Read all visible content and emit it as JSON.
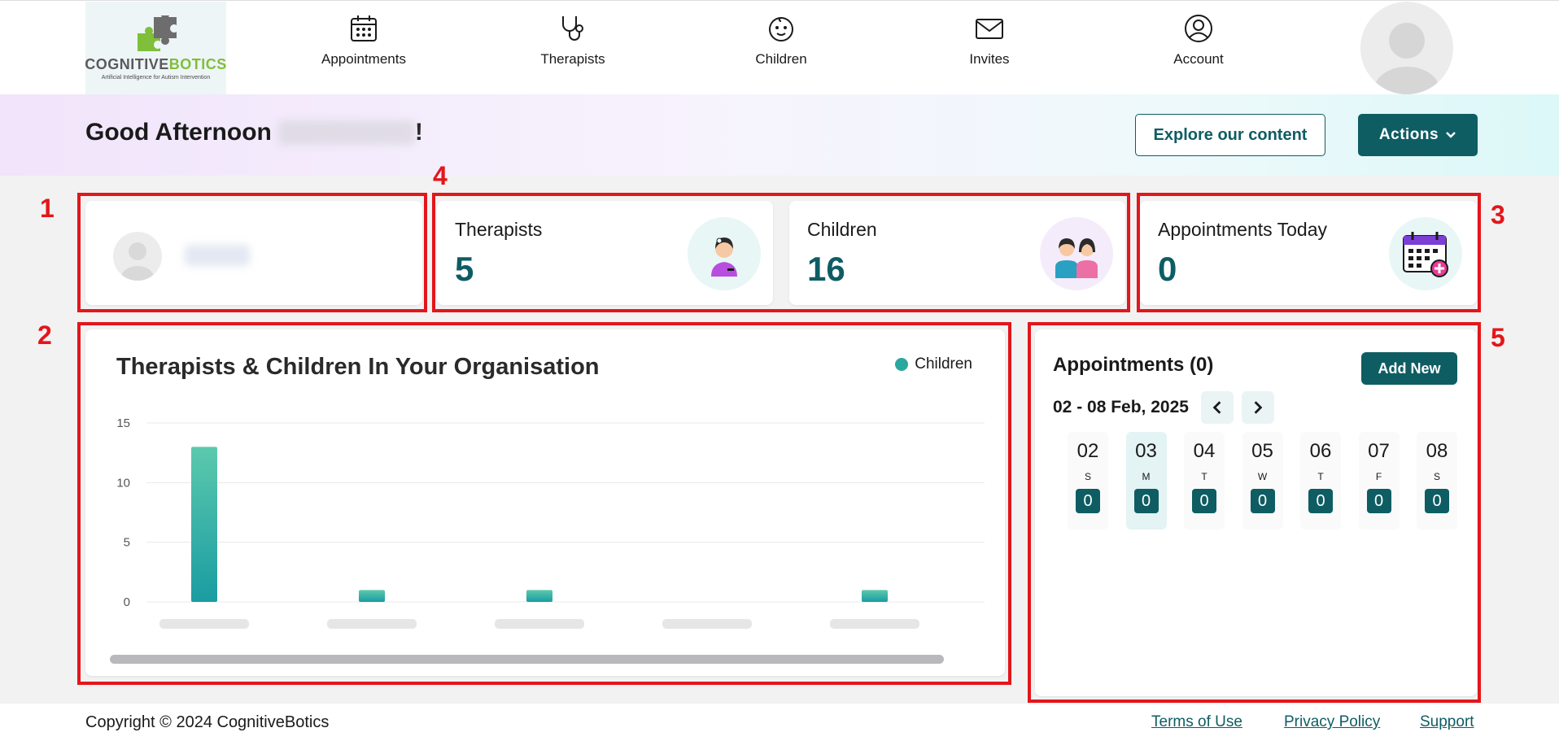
{
  "brand": {
    "name_part1": "COGNITIVE",
    "name_part2": "BOTICS",
    "tagline": "Artificial Intelligence for Autism Intervention"
  },
  "nav": {
    "items": [
      {
        "label": "Appointments",
        "icon": "calendar-icon"
      },
      {
        "label": "Therapists",
        "icon": "stethoscope-icon"
      },
      {
        "label": "Children",
        "icon": "baby-face-icon"
      },
      {
        "label": "Invites",
        "icon": "envelope-icon"
      },
      {
        "label": "Account",
        "icon": "user-circle-icon"
      }
    ]
  },
  "greeting": {
    "prefix": "Good Afternoon",
    "suffix": "!"
  },
  "header_buttons": {
    "explore": "Explore our content",
    "actions": "Actions"
  },
  "annotations": [
    "1",
    "2",
    "3",
    "4",
    "5"
  ],
  "stats": {
    "therapists": {
      "label": "Therapists",
      "value": "5"
    },
    "children": {
      "label": "Children",
      "value": "16"
    },
    "appointments_today": {
      "label": "Appointments Today",
      "value": "0"
    }
  },
  "chart": {
    "legend": "Children",
    "ticks": [
      "15",
      "10",
      "5",
      "0"
    ]
  },
  "chart_data": {
    "type": "bar",
    "title": "Therapists & Children In Your Organisation",
    "xlabel": "",
    "ylabel": "",
    "ylim": [
      0,
      15
    ],
    "grid": true,
    "legend_position": "top-right",
    "series": [
      {
        "name": "Children",
        "color": "#2aa89f",
        "values": [
          13,
          1,
          1,
          0,
          1
        ]
      }
    ],
    "categories_blurred": true
  },
  "appointments": {
    "title": "Appointments (0)",
    "add_label": "Add New",
    "week": "02 - 08 Feb, 2025",
    "days": [
      {
        "num": "02",
        "letter": "S",
        "count": "0",
        "active": false
      },
      {
        "num": "03",
        "letter": "M",
        "count": "0",
        "active": true
      },
      {
        "num": "04",
        "letter": "T",
        "count": "0",
        "active": false
      },
      {
        "num": "05",
        "letter": "W",
        "count": "0",
        "active": false
      },
      {
        "num": "06",
        "letter": "T",
        "count": "0",
        "active": false
      },
      {
        "num": "07",
        "letter": "F",
        "count": "0",
        "active": false
      },
      {
        "num": "08",
        "letter": "S",
        "count": "0",
        "active": false
      }
    ]
  },
  "footer": {
    "copyright": "Copyright © 2024 CognitiveBotics",
    "terms": "Terms of Use",
    "privacy": "Privacy Policy",
    "support": "Support"
  },
  "colors": {
    "primary": "#0e5d63",
    "bar": "#2aa89f",
    "annotation": "#e3161b"
  }
}
